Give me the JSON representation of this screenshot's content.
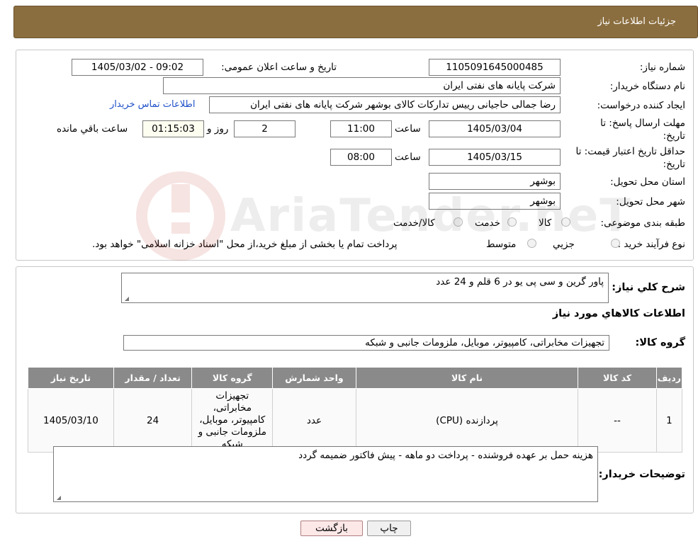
{
  "header": {
    "title": "جزئیات اطلاعات نیاز"
  },
  "form": {
    "need_number_label": "شماره نیاز:",
    "need_number": "1105091645000485",
    "announce_label": "تاریخ و ساعت اعلان عمومی:",
    "announce_value": "1405/03/02 - 09:02",
    "buyer_org_label": "نام دستگاه خریدار:",
    "buyer_org": "شرکت پایانه های نفتی ایران",
    "requester_label": "ایجاد کننده درخواست:",
    "requester": "رضا جمالی حاجیانی رییس تدارکات کالای بوشهر شرکت پایانه های نفتی ایران",
    "buyer_contact_link": "اطلاعات تماس خریدار",
    "deadline_label_1": "مهلت ارسال پاسخ: تا",
    "deadline_label_2": "تاریخ:",
    "deadline_date": "1405/03/04",
    "time_label": "ساعت",
    "deadline_time": "11:00",
    "days_value": "2",
    "days_label": "روز و",
    "remaining_time": "01:15:03",
    "remaining_label": "ساعت باقي مانده",
    "validity_label_1": "حداقل تاریخ اعتبار قیمت: تا",
    "validity_label_2": "تاریخ:",
    "validity_date": "1405/03/15",
    "validity_time": "08:00",
    "province_label": "استان محل تحویل:",
    "province": "بوشهر",
    "city_label": "شهر محل تحویل:",
    "city": "بوشهر",
    "category_label": "طبقه بندی موضوعی:",
    "category_options": [
      "کالا",
      "خدمت",
      "کالا/خدمت"
    ],
    "process_label": "نوع فرآیند خرید :",
    "process_options": [
      "جزیي",
      "متوسط"
    ],
    "process_note": "پرداخت تمام یا بخشی از مبلغ خرید،از محل \"اسناد خزانه اسلامی\" خواهد بود."
  },
  "description": {
    "label": "شرح کلي نياز:",
    "value": "پاور گرین و سی پی یو در 6 قلم و 24 عدد"
  },
  "goods_info": {
    "title": "اطلاعات کالاهاي مورد نياز",
    "group_label": "گروه کالا:",
    "group_value": "تجهیزات مخابراتی، کامپیوتر، موبایل، ملزومات جانبی و شبکه"
  },
  "table": {
    "headers": [
      "رديف",
      "کد کالا",
      "نام کالا",
      "واحد شمارش",
      "گروه کالا",
      "تعداد / مقدار",
      "تاريخ نياز"
    ],
    "rows": [
      {
        "row": "1",
        "code": "--",
        "name": "پردازنده (CPU)",
        "unit": "عدد",
        "group": "تجهیزات مخابراتی، کامپیوتر، موبایل، ملزومات جانبی و شبکه",
        "qty": "24",
        "date": "1405/03/10"
      }
    ]
  },
  "buyer_notes": {
    "label": "توضیحات خریدار:",
    "value": "هزینه حمل بر عهده فروشنده - پرداخت دو ماهه - پیش فاکتور ضمیمه گردد"
  },
  "buttons": {
    "print": "چاپ",
    "back": "بازگشت"
  },
  "watermark": {
    "text": "AriaTender.neT"
  }
}
